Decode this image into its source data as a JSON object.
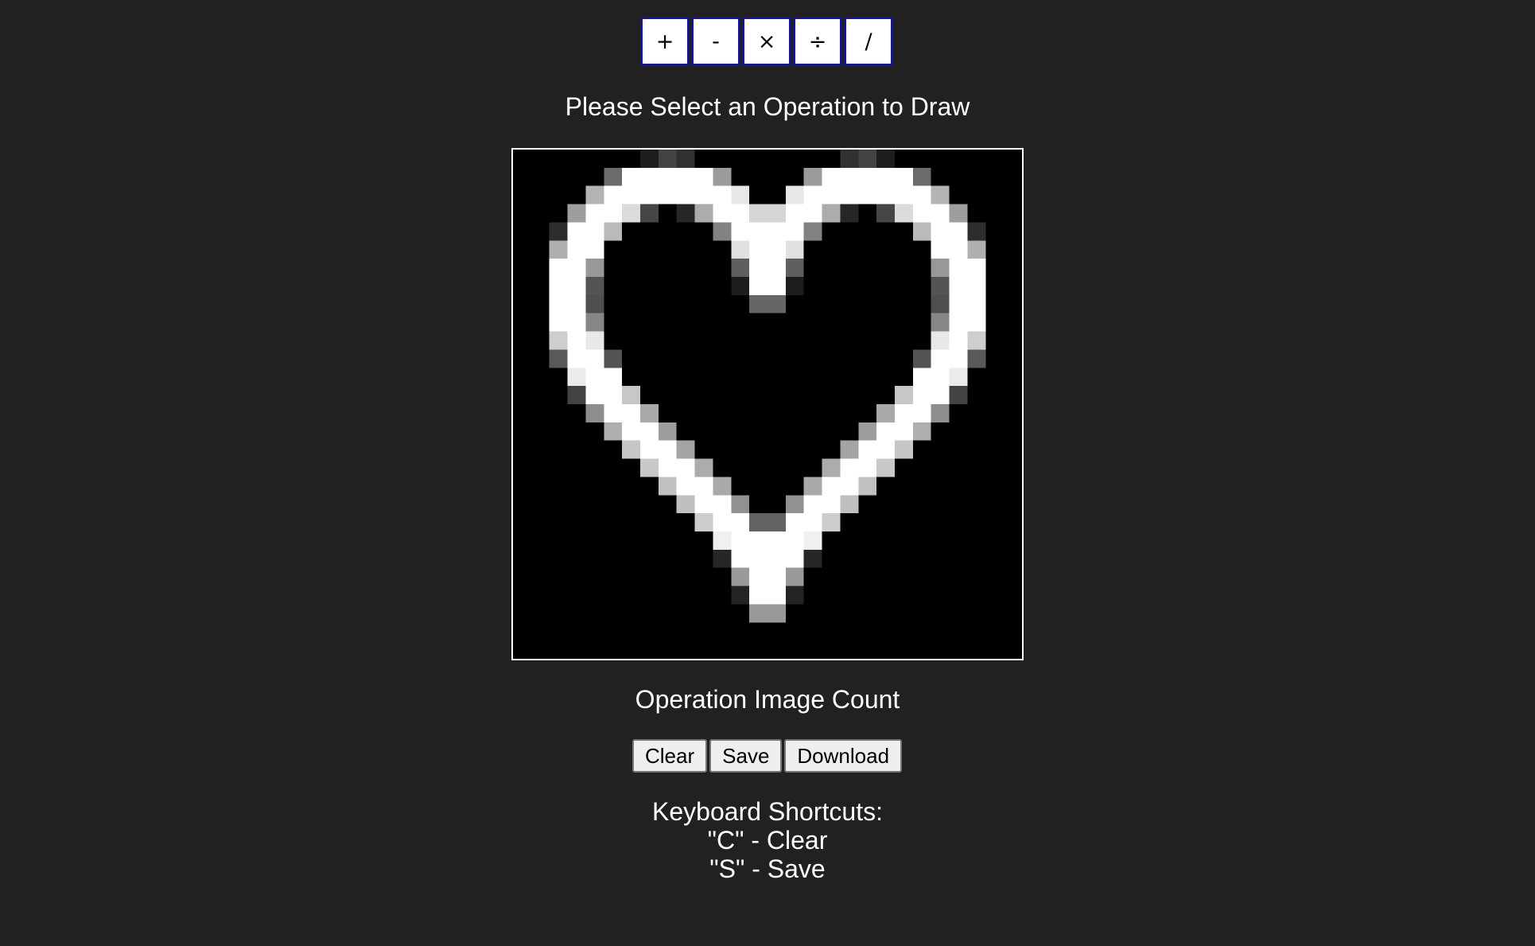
{
  "operations": [
    {
      "symbol": "+",
      "icon": "plus-icon"
    },
    {
      "symbol": "-",
      "icon": "minus-icon"
    },
    {
      "symbol": "×",
      "icon": "multiply-icon"
    },
    {
      "symbol": "÷",
      "icon": "divide-icon"
    },
    {
      "symbol": "/",
      "icon": "slash-icon"
    }
  ],
  "prompt": "Please Select an Operation to Draw",
  "count_label": "Operation Image Count",
  "actions": {
    "clear": "Clear",
    "save": "Save",
    "download": "Download"
  },
  "shortcuts": {
    "title": "Keyboard Shortcuts:",
    "items": [
      "\"C\" - Clear",
      "\"S\" - Save"
    ]
  },
  "colors": {
    "background": "#212121",
    "canvas": "#000000",
    "op_border": "#1010c8"
  }
}
